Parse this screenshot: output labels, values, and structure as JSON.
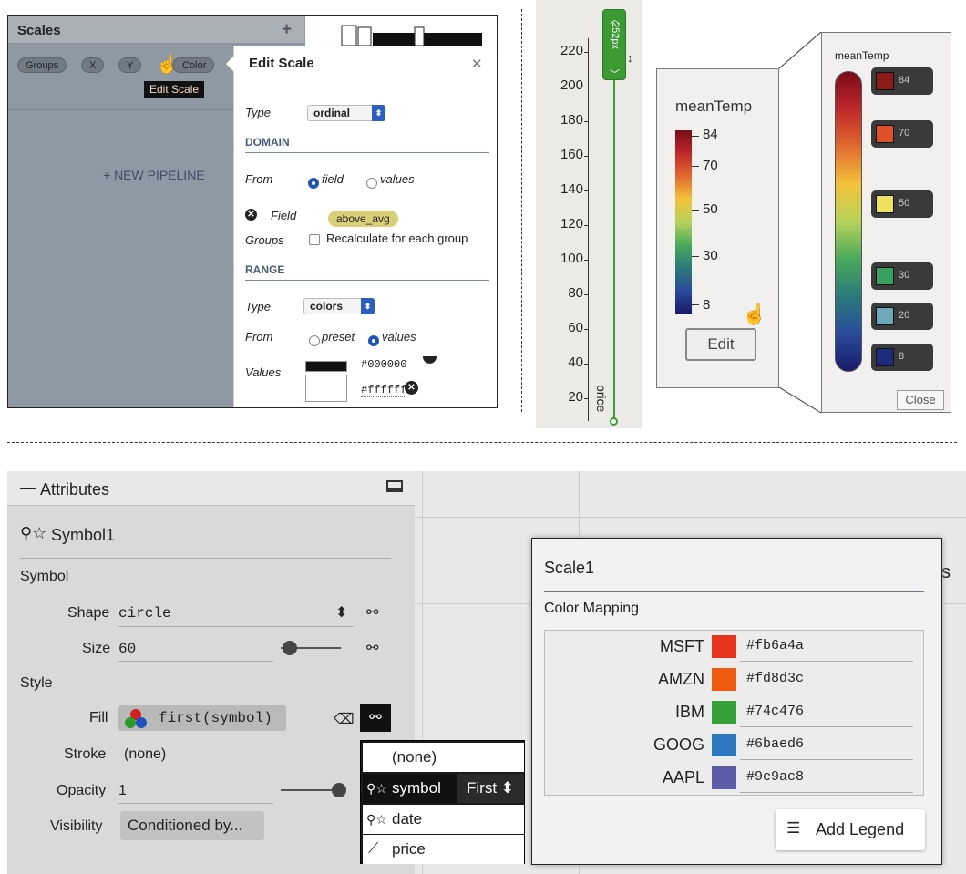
{
  "scales_panel": {
    "title": "Scales",
    "add_label": "+",
    "chips": [
      "Groups",
      "X",
      "Y",
      "Color"
    ],
    "tooltip": "Edit Scale",
    "new_pipeline": "+ NEW PIPELINE"
  },
  "edit_scale": {
    "title": "Edit Scale",
    "close": "✕",
    "type_label": "Type",
    "type_value": "ordinal",
    "domain_header": "DOMAIN",
    "from_label": "From",
    "from_field": "field",
    "from_values": "values",
    "field_label": "Field",
    "field_value": "above_avg",
    "groups_label": "Groups",
    "recalc_label": "Recalculate for each group",
    "range_header": "RANGE",
    "range_type_label": "Type",
    "range_type_value": "colors",
    "range_from_label": "From",
    "range_preset": "preset",
    "range_values": "values",
    "values_label": "Values",
    "value1": "#000000",
    "value2": "#ffffff"
  },
  "axis_panel": {
    "ticks": [
      "220",
      "200",
      "180",
      "160",
      "140",
      "120",
      "100",
      "80",
      "60",
      "40",
      "20"
    ],
    "handle_label": "252px",
    "axis_title": "price"
  },
  "legend": {
    "title": "meanTemp",
    "ticks": [
      "84",
      "70",
      "50",
      "30",
      "8"
    ],
    "edit_button": "Edit"
  },
  "legend_editor": {
    "title": "meanTemp",
    "stops": [
      {
        "value": "84",
        "color": "#8b1a1a"
      },
      {
        "value": "70",
        "color": "#e0502a"
      },
      {
        "value": "50",
        "color": "#f0e060"
      },
      {
        "value": "30",
        "color": "#3aa060"
      },
      {
        "value": "20",
        "color": "#6fa8b8"
      },
      {
        "value": "8",
        "color": "#1e2a7a"
      }
    ],
    "close_button": "Close"
  },
  "attributes": {
    "title": "Attributes",
    "collapse": "—",
    "mark_name": "Symbol1",
    "section_symbol": "Symbol",
    "shape_label": "Shape",
    "shape_value": "circle",
    "size_label": "Size",
    "size_value": "60",
    "section_style": "Style",
    "fill_label": "Fill",
    "fill_value": "first(symbol)",
    "stroke_label": "Stroke",
    "stroke_value": "(none)",
    "opacity_label": "Opacity",
    "opacity_value": "1",
    "visibility_label": "Visibility",
    "visibility_value": "Conditioned by..."
  },
  "dropdown": {
    "items": [
      "(none)",
      "symbol",
      "date",
      "price"
    ],
    "aggregate": "First ⬍"
  },
  "scale_panel": {
    "title": "Scale1",
    "section": "Color Mapping",
    "rows": [
      {
        "name": "MSFT",
        "color": "#e8331c",
        "hex": "#fb6a4a"
      },
      {
        "name": "AMZN",
        "color": "#f05a10",
        "hex": "#fd8d3c"
      },
      {
        "name": "IBM",
        "color": "#35a035",
        "hex": "#74c476"
      },
      {
        "name": "GOOG",
        "color": "#2e78c0",
        "hex": "#6baed6"
      },
      {
        "name": "AAPL",
        "color": "#5c5ca8",
        "hex": "#9e9ac8"
      }
    ],
    "add_legend": "Add Legend"
  }
}
